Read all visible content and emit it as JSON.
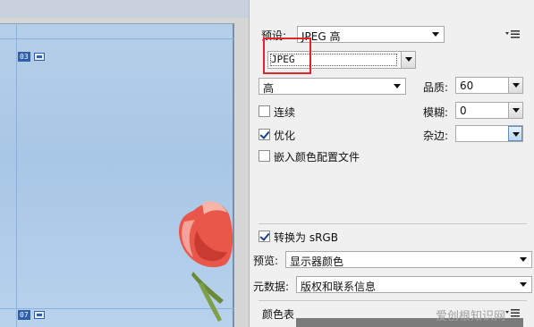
{
  "preview": {
    "slice_top_id": "03",
    "slice_bottom_id": "07"
  },
  "settings": {
    "preset_label": "预设:",
    "preset_value": "JPEG 高",
    "format_value": "JPEG",
    "quality_level_value": "高",
    "quality_label": "品质:",
    "quality_value": "60",
    "progressive_label": "连续",
    "progressive_checked": false,
    "blur_label": "模糊:",
    "blur_value": "0",
    "optimized_label": "优化",
    "optimized_checked": true,
    "matte_label": "杂边:",
    "matte_value": "",
    "embed_profile_label": "嵌入颜色配置文件",
    "embed_profile_checked": false,
    "convert_srgb_label": "转换为 sRGB",
    "convert_srgb_checked": true,
    "preview_label": "预览:",
    "preview_value": "显示器颜色",
    "metadata_label": "元数据:",
    "metadata_value": "版权和联系信息",
    "color_table_label": "颜色表"
  },
  "watermark": "爱创根知识网",
  "colors": {
    "highlight": "#e0262b",
    "check_mark": "#1d3f8a"
  }
}
